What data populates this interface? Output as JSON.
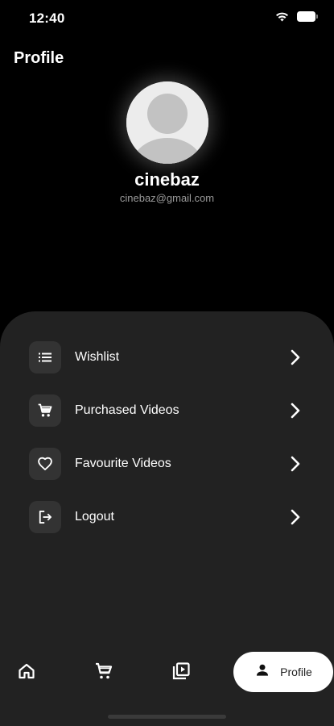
{
  "status_bar": {
    "time": "12:40",
    "wifi_icon": "wifi-icon",
    "battery_icon": "battery-icon"
  },
  "header": {
    "title": "Profile"
  },
  "profile": {
    "avatar_icon": "avatar-placeholder-icon",
    "name": "cinebaz",
    "email": "cinebaz@gmail.com"
  },
  "menu": {
    "items": [
      {
        "label": "Wishlist",
        "icon": "list-icon"
      },
      {
        "label": "Purchased Videos",
        "icon": "cart-icon"
      },
      {
        "label": "Favourite Videos",
        "icon": "heart-icon"
      },
      {
        "label": "Logout",
        "icon": "logout-icon"
      }
    ],
    "chevron_icon": "chevron-right-icon"
  },
  "bottom_nav": {
    "items": [
      {
        "icon": "home-icon"
      },
      {
        "icon": "cart-icon"
      },
      {
        "icon": "video-library-icon"
      },
      {
        "icon": "person-icon",
        "label": "Profile",
        "active": true
      }
    ]
  },
  "colors": {
    "background": "#000000",
    "sheet": "#222222",
    "icon_box": "#333333",
    "active_pill": "#ffffff",
    "email_text": "#9a9a9a"
  }
}
